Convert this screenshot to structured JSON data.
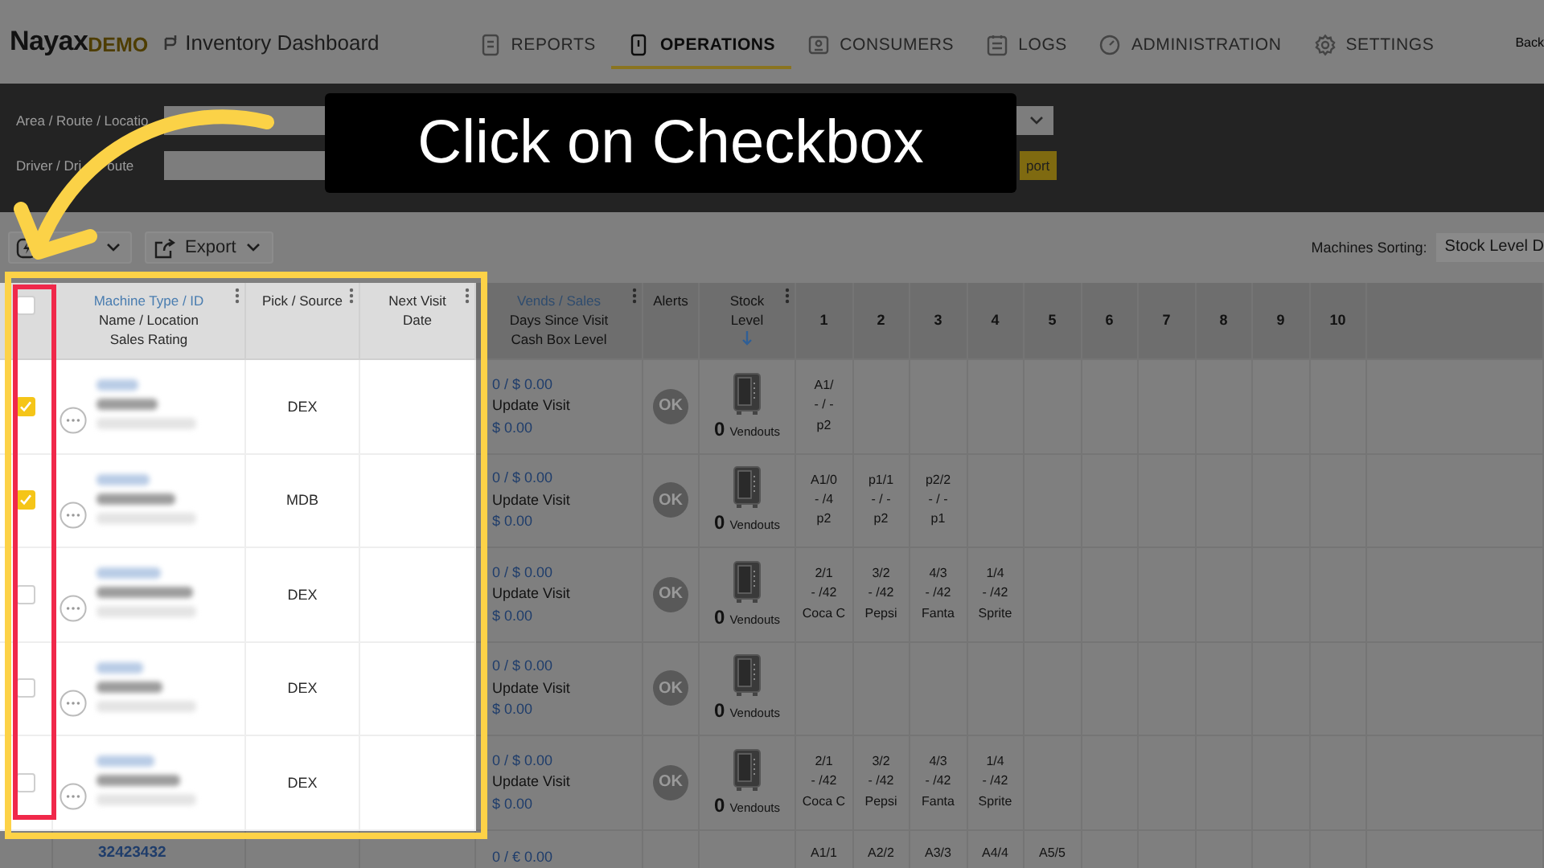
{
  "header": {
    "brand": "Nayax",
    "brand_suffix": "DEMO",
    "app_title": "Inventory Dashboard",
    "nav": [
      {
        "label": "REPORTS",
        "selected": false
      },
      {
        "label": "OPERATIONS",
        "selected": true
      },
      {
        "label": "CONSUMERS",
        "selected": false
      },
      {
        "label": "LOGS",
        "selected": false
      },
      {
        "label": "ADMINISTRATION",
        "selected": false
      },
      {
        "label": "SETTINGS",
        "selected": false
      }
    ],
    "back_link": "Back"
  },
  "filters": {
    "area_label": "Area / Route / Locatio",
    "driver_label_parts": [
      "Driver / Dri",
      "oute"
    ],
    "action_button": "port"
  },
  "toolbar": {
    "export_button": "Export",
    "sorting_label": "Machines Sorting:",
    "sorting_value": "Stock Level D"
  },
  "table": {
    "select_all": {
      "checked": false
    },
    "columns": [
      {
        "title": "Machine Type / ID",
        "subtitles": [
          "Name / Location",
          "Sales Rating"
        ],
        "kind": "link",
        "menu": true,
        "sorted": false
      },
      {
        "title": "Pick / Source",
        "kind": "plain",
        "menu": true,
        "sorted": false
      },
      {
        "title": "Next Visit",
        "subtitles": [
          "Date"
        ],
        "kind": "plain",
        "menu": true,
        "sorted": false
      },
      {
        "title": "Vends / Sales",
        "subtitles": [
          "Days Since Visit",
          "Cash Box Level"
        ],
        "kind": "link",
        "menu": true,
        "sorted": false
      },
      {
        "title": "Alerts",
        "kind": "plain",
        "menu": false,
        "sorted": false
      },
      {
        "title": "Stock",
        "subtitles": [
          "Level"
        ],
        "kind": "plain",
        "menu": true,
        "sorted": true
      },
      {
        "title": "1",
        "kind": "slot"
      },
      {
        "title": "2",
        "kind": "slot"
      },
      {
        "title": "3",
        "kind": "slot"
      },
      {
        "title": "4",
        "kind": "slot"
      },
      {
        "title": "5",
        "kind": "slot"
      },
      {
        "title": "6",
        "kind": "slot"
      },
      {
        "title": "7",
        "kind": "slot"
      },
      {
        "title": "8",
        "kind": "slot"
      },
      {
        "title": "9",
        "kind": "slot"
      },
      {
        "title": "10",
        "kind": "slot"
      }
    ],
    "rows": [
      {
        "kind": "blurred",
        "checked": true,
        "source": "DEX",
        "vends": "0 / $ 0.00",
        "visit": "Update Visit",
        "cash": "$ 0.00",
        "alert": "OK",
        "stock_count": "0",
        "stock_label": "Vendouts",
        "slots": [
          [
            "A1/",
            "- / -",
            "p2"
          ]
        ]
      },
      {
        "kind": "blurred",
        "checked": true,
        "source": "MDB",
        "vends": "0 / $ 0.00",
        "visit": "Update Visit",
        "cash": "$ 0.00",
        "alert": "OK",
        "stock_count": "0",
        "stock_label": "Vendouts",
        "slots": [
          [
            "A1/0",
            "- /4",
            "p2"
          ],
          [
            "p1/1",
            "- / -",
            "p2"
          ],
          [
            "p2/2",
            "- / -",
            "p1"
          ]
        ]
      },
      {
        "kind": "blurred",
        "checked": false,
        "source": "DEX",
        "vends": "0 / $ 0.00",
        "visit": "Update Visit",
        "cash": "$ 0.00",
        "alert": "OK",
        "stock_count": "0",
        "stock_label": "Vendouts",
        "slots": [
          [
            "2/1",
            "- /42",
            "Coca C"
          ],
          [
            "3/2",
            "- /42",
            "Pepsi"
          ],
          [
            "4/3",
            "- /42",
            "Fanta"
          ],
          [
            "1/4",
            "- /42",
            "Sprite"
          ]
        ]
      },
      {
        "kind": "blurred",
        "checked": false,
        "source": "DEX",
        "vends": "0 / $ 0.00",
        "visit": "Update Visit",
        "cash": "$ 0.00",
        "alert": "OK",
        "stock_count": "0",
        "stock_label": "Vendouts",
        "slots": []
      },
      {
        "kind": "blurred",
        "checked": false,
        "source": "DEX",
        "vends": "0 / $ 0.00",
        "visit": "Update Visit",
        "cash": "$ 0.00",
        "alert": "OK",
        "stock_count": "0",
        "stock_label": "Vendouts",
        "slots": [
          [
            "2/1",
            "- /42",
            "Coca C"
          ],
          [
            "3/2",
            "- /42",
            "Pepsi"
          ],
          [
            "4/3",
            "- /42",
            "Fanta"
          ],
          [
            "1/4",
            "- /42",
            "Sprite"
          ]
        ]
      },
      {
        "kind": "cut",
        "machine_id": "32423432",
        "vends": "0 / € 0.00",
        "slots": [
          [
            "A1/1"
          ],
          [
            "A2/2"
          ],
          [
            "A3/3"
          ],
          [
            "A4/4"
          ],
          [
            "A5/5"
          ]
        ]
      }
    ]
  },
  "tutorial": {
    "caption": "Click on Checkbox"
  }
}
